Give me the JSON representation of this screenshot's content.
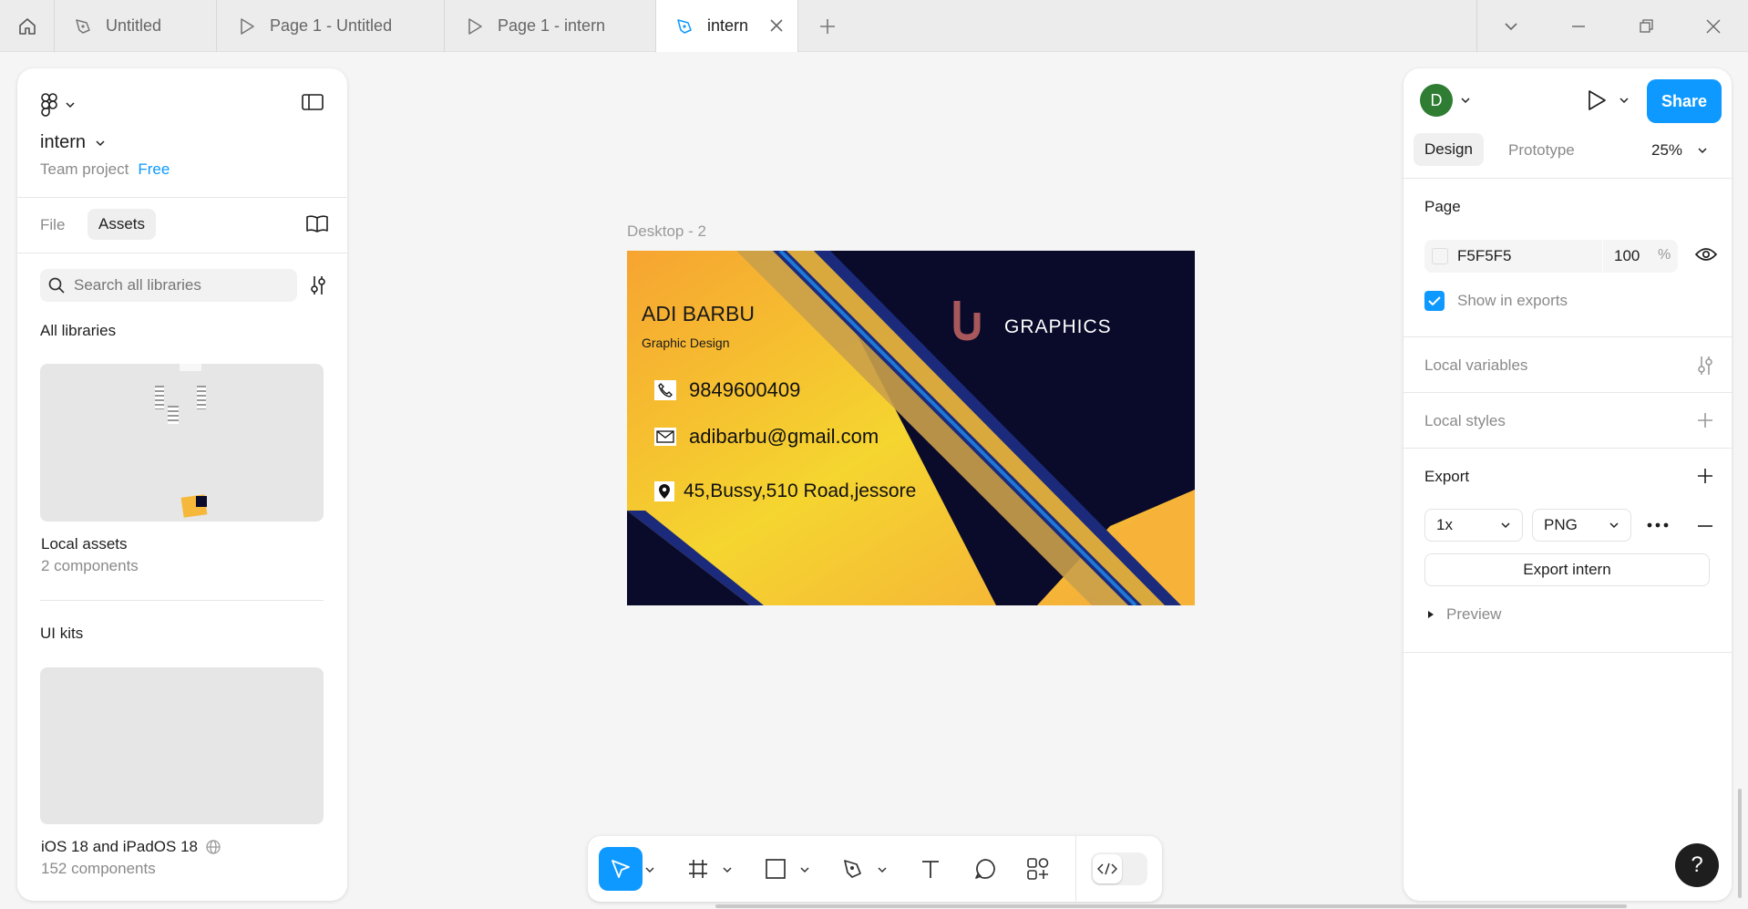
{
  "tabs": [
    {
      "label": "Untitled",
      "icon": "pen-tool-icon"
    },
    {
      "label": "Page 1 - Untitled",
      "icon": "play-icon"
    },
    {
      "label": "Page 1 - intern",
      "icon": "play-icon"
    },
    {
      "label": "intern",
      "icon": "pen-tool-icon",
      "active": true
    }
  ],
  "left_panel": {
    "file_name": "intern",
    "project": "Team project",
    "plan": "Free",
    "tab_file": "File",
    "tab_assets": "Assets",
    "search_placeholder": "Search all libraries",
    "all_libraries": "All libraries",
    "local_assets": {
      "title": "Local assets",
      "subtitle": "2 components"
    },
    "ui_kits_heading": "UI kits",
    "ui_kit": {
      "title": "iOS 18 and iPadOS 18",
      "subtitle": "152 components"
    }
  },
  "canvas": {
    "frame_label": "Desktop - 2",
    "card": {
      "name": "ADI BARBU",
      "role": "Graphic Design",
      "phone": "9849600409",
      "email": "adibarbu@gmail.com",
      "address": "45,Bussy,510 Road,jessore",
      "brand": "GRAPHICS"
    }
  },
  "right_panel": {
    "avatar_letter": "D",
    "share_label": "Share",
    "tab_design": "Design",
    "tab_prototype": "Prototype",
    "zoom": "25%",
    "page_heading": "Page",
    "page_color": "F5F5F5",
    "page_opacity": "100",
    "percent_sign": "%",
    "show_in_exports": "Show in exports",
    "local_variables": "Local variables",
    "local_styles": "Local styles",
    "export_heading": "Export",
    "export_scale": "1x",
    "export_format": "PNG",
    "export_button": "Export intern",
    "preview_label": "Preview"
  },
  "help_label": "?",
  "colors": {
    "accent": "#0d99ff",
    "avatar": "#2e7d32",
    "card_navy": "#0a0a2a",
    "card_yellow": "#f5c23a"
  }
}
